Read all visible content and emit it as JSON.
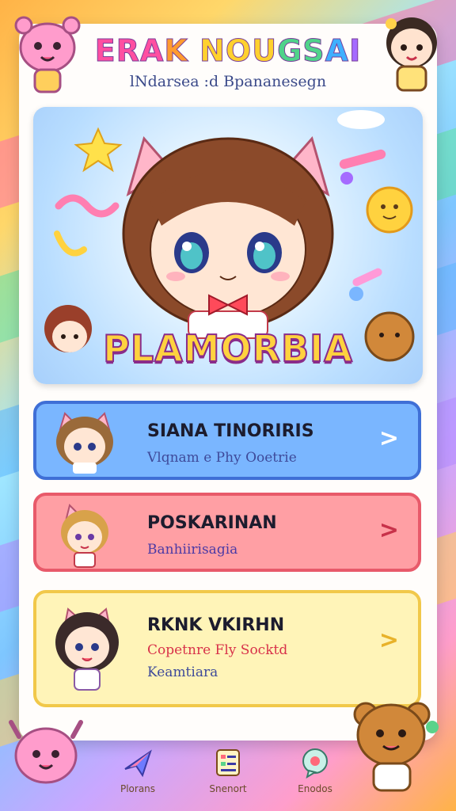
{
  "app": {
    "title_parts": [
      "ERA",
      "K ",
      "NOU",
      "GS",
      "A",
      "I"
    ],
    "subtitle": "lNdarsea :d Bpananesegn"
  },
  "hero": {
    "name": "PLAMORBIA"
  },
  "menu": [
    {
      "title": "SIANA TINORIRIS",
      "subtitle": "Vlqnam e Phy Ooetrie",
      "subtitle_color": "#3e4a9a"
    },
    {
      "title": "POSKARINAN",
      "subtitle": "Banhiirisagia",
      "subtitle_color": "#4b3aa5"
    },
    {
      "title": "RKNK VKIRHN",
      "subtitle": "Copetnre Fly Socktd",
      "subtitle_color": "#d8324a",
      "subtitle2": "Keamtiara",
      "subtitle2_color": "#3e4a9a"
    }
  ],
  "chevron": ">",
  "nav": [
    {
      "label": "Plorans",
      "icon": "paper-plane-icon"
    },
    {
      "label": "Snenort",
      "icon": "notepad-icon"
    },
    {
      "label": "Enodos",
      "icon": "speech-bubble-icon"
    }
  ],
  "colors": {
    "menu1_bg": "#7ab6ff",
    "menu2_bg": "#ff9fa4",
    "menu3_bg": "#fff4b8"
  }
}
